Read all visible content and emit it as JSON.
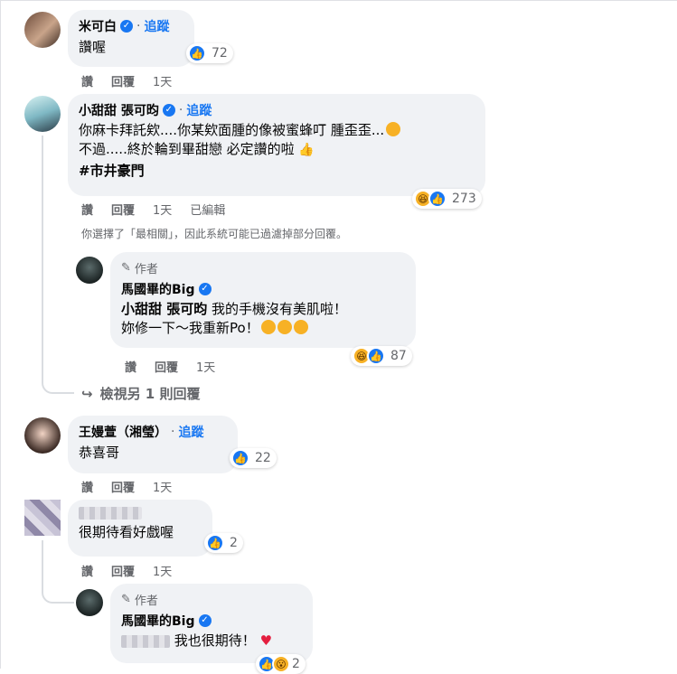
{
  "comments": [
    {
      "name": "米可白",
      "follow": "追蹤",
      "text": "讚喔",
      "reaction_count": "72",
      "like": "讚",
      "reply": "回覆",
      "time": "1天"
    },
    {
      "name": "小甜甜 張可昀",
      "follow": "追蹤",
      "line1": "你麻卡拜託欸....你某欸面腫的像被蜜蜂叮 腫歪歪...",
      "line2": "不過.....終於輪到畢甜戀 必定讚的啦",
      "hashtag": "#市井豪門",
      "reaction_count": "273",
      "like": "讚",
      "reply": "回覆",
      "time": "1天",
      "edited": "已編輯",
      "filter_note": "你選擇了「最相關」，因此系統可能已過濾掉部分回覆。"
    },
    {
      "author_tag": "作者",
      "name": "馬國畢的Big",
      "mention": "小甜甜 張可昀",
      "line1": "我的手機沒有美肌啦！",
      "line2": "妳修一下～我重新Po！",
      "reaction_count": "87",
      "like": "讚",
      "reply": "回覆",
      "time": "1天"
    },
    {
      "more_replies": "檢視另 1 則回覆"
    },
    {
      "name": "王嫚萱（湘瑩）",
      "follow": "追蹤",
      "text": "恭喜哥",
      "reaction_count": "22",
      "like": "讚",
      "reply": "回覆",
      "time": "1天"
    },
    {
      "text": "很期待看好戲喔",
      "reaction_count": "2",
      "like": "讚",
      "reply": "回覆",
      "time": "1天"
    },
    {
      "author_tag": "作者",
      "name": "馬國畢的Big",
      "text": "我也很期待！",
      "reaction_count": "2"
    }
  ],
  "colors": {
    "accent": "#1877f2",
    "bubble": "#f0f2f5",
    "muted": "#65676b"
  }
}
